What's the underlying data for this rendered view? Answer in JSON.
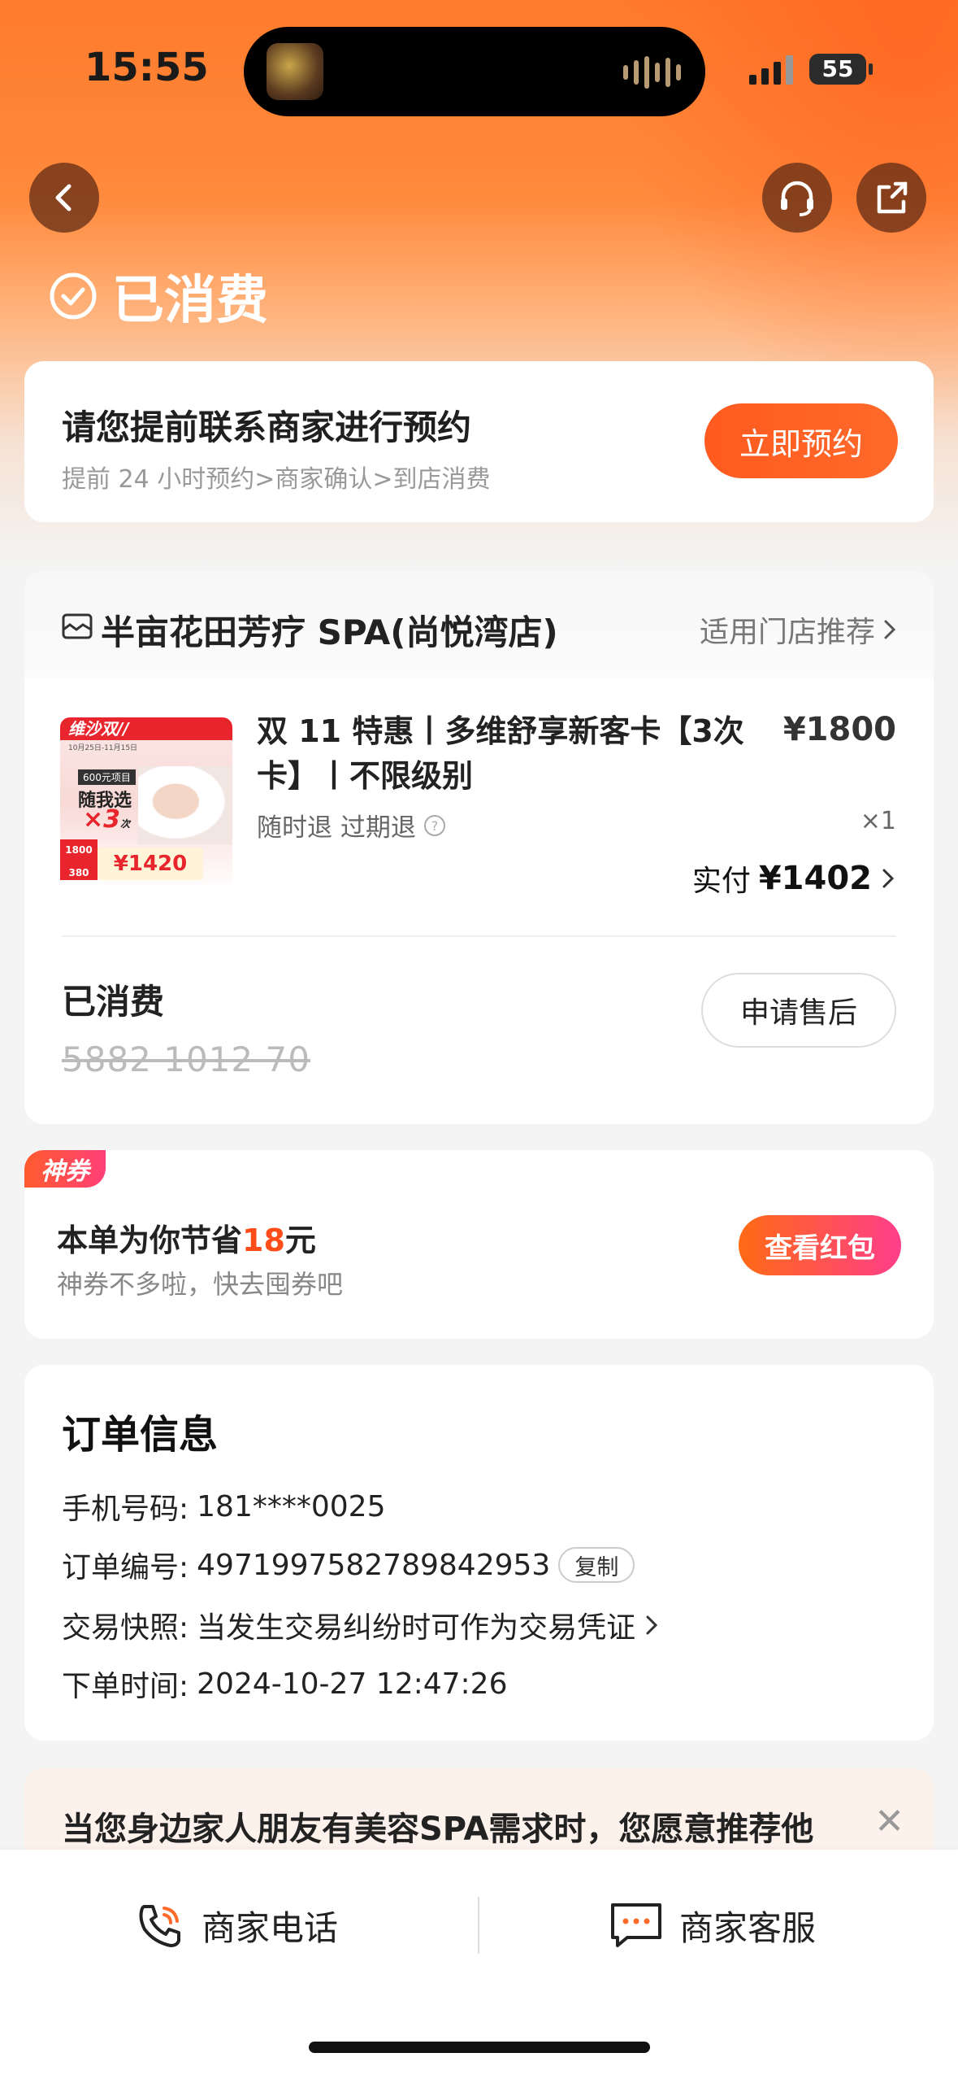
{
  "status_bar": {
    "time": "15:55",
    "battery": "55"
  },
  "header": {
    "status_title": "已消费"
  },
  "booking": {
    "title": "请您提前联系商家进行预约",
    "subtitle": "提前 24 小时预约>商家确认>到店消费",
    "button": "立即预约"
  },
  "shop": {
    "name": "半亩花田芳疗 SPA(尚悦湾店)",
    "link": "适用门店推荐"
  },
  "product": {
    "title": "双 11 特惠丨多维舒享新客卡【3次卡】丨不限级别",
    "price": "¥1800",
    "tags": "随时退 过期退",
    "qty": "×1",
    "paid_label": "实付",
    "paid_amount": "¥1402",
    "thumb": {
      "banner": "维沙双//",
      "dates": "10月25日-11月15日",
      "tag600": "600元项目",
      "line1": "随我选",
      "times": "3",
      "times_suffix": "次",
      "price_orig": "1800",
      "reduce": "380",
      "deal": "¥1420"
    }
  },
  "consumption": {
    "label": "已消费",
    "code": "5882 1012 70",
    "after_sale_button": "申请售后"
  },
  "coupon": {
    "tag": "神券",
    "title_prefix": "本单为你节省",
    "amount": "18",
    "title_suffix": "元",
    "subtitle": "神券不多啦，快去囤券吧",
    "button": "查看红包"
  },
  "order_info": {
    "title": "订单信息",
    "phone_label": "手机号码:",
    "phone": "181****0025",
    "order_no_label": "订单编号:",
    "order_no": "4971997582789842953",
    "copy_button": "复制",
    "snapshot_label": "交易快照:",
    "snapshot_text": "当发生交易纠纷时可作为交易凭证",
    "time_label": "下单时间:",
    "time": "2024-10-27 12:47:26"
  },
  "survey": {
    "text": "当您身边家人朋友有美容SPA需求时，您愿意推荐他"
  },
  "bottom_bar": {
    "phone_label": "商家电话",
    "service_label": "商家客服"
  },
  "colors": {
    "accent": "#ff5a1f",
    "coupon_pink": "#ff3e8a"
  }
}
